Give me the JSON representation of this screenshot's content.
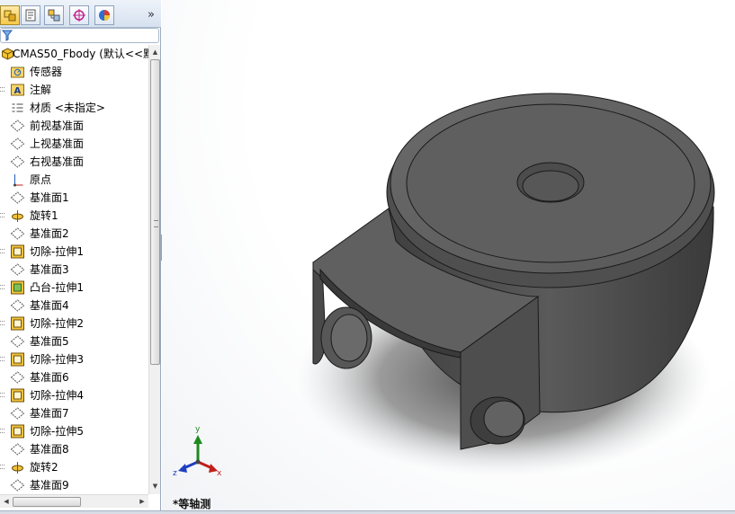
{
  "feature_tree": {
    "root_label": "CMAS50_Fbody  (默认<<默",
    "items": [
      {
        "label": "传感器",
        "icon": "sensor-folder-icon",
        "expandable": false
      },
      {
        "label": "注解",
        "icon": "annotation-folder-icon",
        "expandable": true
      },
      {
        "label": "材质 <未指定>",
        "icon": "material-icon",
        "expandable": false
      },
      {
        "label": "前视基准面",
        "icon": "plane-icon",
        "expandable": false
      },
      {
        "label": "上视基准面",
        "icon": "plane-icon",
        "expandable": false
      },
      {
        "label": "右视基准面",
        "icon": "plane-icon",
        "expandable": false
      },
      {
        "label": "原点",
        "icon": "origin-icon",
        "expandable": false
      },
      {
        "label": "基准面1",
        "icon": "plane-icon",
        "expandable": false
      },
      {
        "label": "旋转1",
        "icon": "revolve-icon",
        "expandable": true
      },
      {
        "label": "基准面2",
        "icon": "plane-icon",
        "expandable": false
      },
      {
        "label": "切除-拉伸1",
        "icon": "cut-extrude-icon",
        "expandable": true
      },
      {
        "label": "基准面3",
        "icon": "plane-icon",
        "expandable": false
      },
      {
        "label": "凸台-拉伸1",
        "icon": "boss-extrude-icon",
        "expandable": true
      },
      {
        "label": "基准面4",
        "icon": "plane-icon",
        "expandable": false
      },
      {
        "label": "切除-拉伸2",
        "icon": "cut-extrude-icon",
        "expandable": true
      },
      {
        "label": "基准面5",
        "icon": "plane-icon",
        "expandable": false
      },
      {
        "label": "切除-拉伸3",
        "icon": "cut-extrude-icon",
        "expandable": true
      },
      {
        "label": "基准面6",
        "icon": "plane-icon",
        "expandable": false
      },
      {
        "label": "切除-拉伸4",
        "icon": "cut-extrude-icon",
        "expandable": true
      },
      {
        "label": "基准面7",
        "icon": "plane-icon",
        "expandable": false
      },
      {
        "label": "切除-拉伸5",
        "icon": "cut-extrude-icon",
        "expandable": true
      },
      {
        "label": "基准面8",
        "icon": "plane-icon",
        "expandable": false
      },
      {
        "label": "旋转2",
        "icon": "revolve-icon",
        "expandable": true
      },
      {
        "label": "基准面9",
        "icon": "plane-icon",
        "expandable": false
      }
    ]
  },
  "panel_tabs": [
    {
      "name": "feature-manager-tab",
      "icon": "feature-tree-icon",
      "active": true
    },
    {
      "name": "property-manager-tab",
      "icon": "property-icon",
      "active": false
    },
    {
      "name": "configuration-manager-tab",
      "icon": "configuration-icon",
      "active": false
    },
    {
      "name": "dimxpert-tab",
      "icon": "crosshair-icon",
      "active": false
    },
    {
      "name": "display-manager-tab",
      "icon": "appearance-pie-icon",
      "active": false
    }
  ],
  "tabs_overflow": "»",
  "viewport": {
    "view_label": "*等轴测",
    "triad": {
      "x": "x",
      "y": "y",
      "z": "z"
    }
  },
  "colors": {
    "part_body": "#555555",
    "edge": "#1a1a1a",
    "panel_border": "#9aa9bd"
  }
}
